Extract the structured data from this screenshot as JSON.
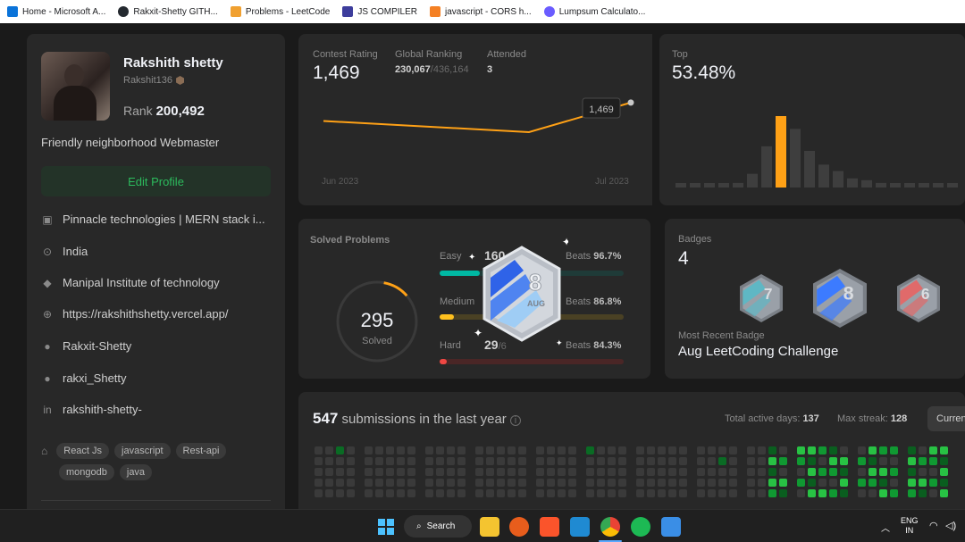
{
  "bookmarks": [
    {
      "label": "Home - Microsoft A...",
      "icon": "azure-icon",
      "color": "#0a73d9"
    },
    {
      "label": "Rakxit-Shetty GITH...",
      "icon": "github-icon",
      "color": "#24292f"
    },
    {
      "label": "Problems - LeetCode",
      "icon": "leetcode-icon",
      "color": "#f0a030"
    },
    {
      "label": "JS COMPILER",
      "icon": "js-icon",
      "color": "#3d3d9c"
    },
    {
      "label": "javascript - CORS h...",
      "icon": "stackoverflow-icon",
      "color": "#f48024"
    },
    {
      "label": "Lumpsum Calculato...",
      "icon": "calculator-icon",
      "color": "#6a5cff"
    }
  ],
  "profile": {
    "name": "Rakshith shetty",
    "username": "Rakshit136",
    "rank_label": "Rank",
    "rank_value": "200,492",
    "bio": "Friendly neighborhood Webmaster",
    "edit_label": "Edit Profile",
    "info": [
      {
        "icon": "briefcase-icon",
        "glyph": "▣",
        "text": "Pinnacle technologies | MERN stack i..."
      },
      {
        "icon": "location-icon",
        "glyph": "⊙",
        "text": "India"
      },
      {
        "icon": "graduation-cap-icon",
        "glyph": "◆",
        "text": "Manipal Institute of technology"
      },
      {
        "icon": "globe-icon",
        "glyph": "⊕",
        "text": "https://rakshithshetty.vercel.app/"
      },
      {
        "icon": "github-icon",
        "glyph": "●",
        "text": "Rakxit-Shetty"
      },
      {
        "icon": "twitter-icon",
        "glyph": "●",
        "text": "rakxi_Shetty"
      },
      {
        "icon": "linkedin-icon",
        "glyph": "in",
        "text": "rakshith-shetty-"
      }
    ],
    "tags_row1": [
      "React Js",
      "javascript",
      "Rest-api"
    ],
    "tags_row2": [
      "mongodb",
      "java"
    ]
  },
  "contest": {
    "rating_label": "Contest Rating",
    "rating_value": "1,469",
    "global_label": "Global Ranking",
    "global_value": "230,067",
    "global_total": "/436,164",
    "attended_label": "Attended",
    "attended_value": "3",
    "tooltip": "1,469",
    "x_start": "Jun 2023",
    "x_end": "Jul 2023",
    "rating_series": [
      1500,
      1480,
      1469
    ],
    "line_color": "#ffa116"
  },
  "top": {
    "label": "Top",
    "value": "53.48%",
    "histogram": [
      2,
      2,
      2,
      3,
      5,
      15,
      45,
      78,
      64,
      40,
      25,
      18,
      10,
      8,
      5,
      3,
      2,
      2,
      2,
      2
    ],
    "highlight_index": 7
  },
  "solved": {
    "label": "Solved Problems",
    "total": "295",
    "sub": "Solved",
    "easy_label": "Easy",
    "easy_count": "160",
    "easy_beats": "Beats",
    "easy_pct": "96.7%",
    "medium_label": "Medium",
    "medium_beats": "Beats",
    "medium_pct": "86.8%",
    "hard_label": "Hard",
    "hard_count": "29",
    "hard_total": "/6",
    "hard_beats": "Beats",
    "hard_pct": "84.3%",
    "easy_fill": 0.22,
    "medium_fill": 0.08,
    "hard_fill": 0.04,
    "colors": {
      "easy": "#00b8a3",
      "medium": "#ffc01e",
      "hard": "#ef4743"
    }
  },
  "medal": {
    "day": "8",
    "month": "AUG"
  },
  "badges": {
    "label": "Badges",
    "count": "4",
    "recent_label": "Most Recent Badge",
    "recent_name": "Aug LeetCoding Challenge",
    "items": [
      {
        "day": "7",
        "color": "#5fb7c4"
      },
      {
        "day": "8",
        "color": "#3c7bff"
      },
      {
        "day": "6",
        "color": "#e06a6a"
      }
    ]
  },
  "submissions": {
    "count": "547",
    "text": "submissions in the last year",
    "active_label": "Total active days:",
    "active_value": "137",
    "streak_label": "Max streak:",
    "streak_value": "128",
    "current_label": "Curren"
  },
  "taskbar": {
    "search_label": "Search",
    "lang_line1": "ENG",
    "lang_line2": "IN"
  }
}
